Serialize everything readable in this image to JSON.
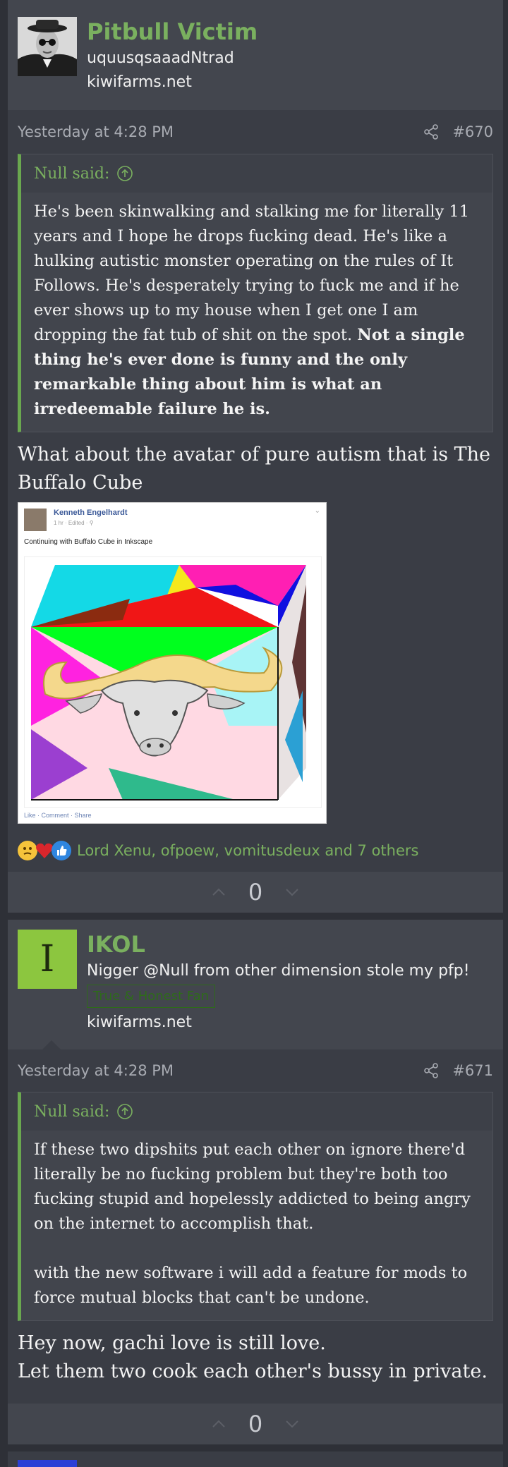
{
  "posts": [
    {
      "username": "Pitbull Victim",
      "user_title": "uquusqsaaadNtrad",
      "site": "kiwifarms.net",
      "date": "Yesterday at 4:28 PM",
      "post_number": "#670",
      "quote_author": "Null said:",
      "quote_text": "He's been skinwalking and stalking me for literally 11 years and I hope he drops fucking dead. He's like a hulking autistic monster operating on the rules of It Follows. He's desperately trying to fuck me and if he ever shows up to my house when I get one I am dropping the fat tub of shit on the spot.",
      "quote_bold": "Not a single thing he's ever done is funny and the only remarkable thing about him is what an irredeemable failure he is.",
      "message": "What about the avatar of pure autism that is The Buffalo Cube",
      "embed": {
        "fb_name": "Kenneth Engelhardt",
        "fb_meta": "1 hr · Edited · ⚲",
        "fb_caption": "Continuing with Buffalo Cube in Inkscape",
        "fb_actions": "Like · Comment · Share"
      },
      "reactions_text": "Lord Xenu, ofpoew, vomitusdeux and 7 others",
      "vote_count": "0"
    },
    {
      "username": "IKOL",
      "avatar_letter": "I",
      "user_title": "Nigger @Null from other dimension stole my pfp!",
      "banner": "True & Honest Fan",
      "site": "kiwifarms.net",
      "date": "Yesterday at 4:28 PM",
      "post_number": "#671",
      "quote_author": "Null said:",
      "quote_p1": "If these two dipshits put each other on ignore there'd literally be no fucking problem but they're both too fucking stupid and hopelessly addicted to being angry on the internet to accomplish that.",
      "quote_p2": "with the new software i will add a feature for mods to force mutual blocks that can't be undone.",
      "message_line1": "Hey now, gachi love is still love.",
      "message_line2": "Let them two cook each other's bussy in private.",
      "vote_count": "0"
    }
  ],
  "colors": {
    "accent_green": "#7ab05f",
    "background": "#2e3037",
    "post_bg": "#3a3d45",
    "header_bg": "#43464e",
    "ikol_avatar": "#8cc63f"
  }
}
